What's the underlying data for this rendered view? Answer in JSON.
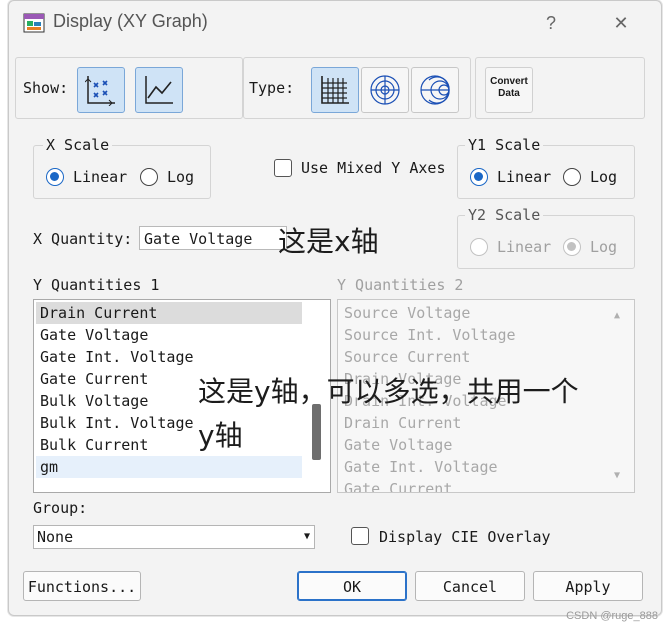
{
  "window": {
    "title": "Display (XY Graph)",
    "help": "?",
    "close": "✕"
  },
  "show": {
    "label": "Show:"
  },
  "type": {
    "label": "Type:"
  },
  "convert": {
    "line1": "Convert",
    "line2": "Data"
  },
  "x_scale": {
    "title": "X Scale",
    "linear": "Linear",
    "log": "Log",
    "selected": "Linear"
  },
  "mixed_axes": {
    "label": "Use Mixed Y Axes",
    "checked": false
  },
  "y1_scale": {
    "title": "Y1 Scale",
    "linear": "Linear",
    "log": "Log",
    "selected": "Linear"
  },
  "y2_scale": {
    "title": "Y2 Scale",
    "linear": "Linear",
    "log": "Log",
    "selected": "Log",
    "enabled": false
  },
  "x_quantity": {
    "label": "X Quantity:",
    "value": "Gate Voltage"
  },
  "y_quantities_1": {
    "label": "Y Quantities 1",
    "items": [
      "Drain Current",
      "Gate Voltage",
      "Gate Int. Voltage",
      "Gate Current",
      "Bulk Voltage",
      "Bulk Int. Voltage",
      "Bulk Current",
      "gm"
    ]
  },
  "y_quantities_2": {
    "label": "Y Quantities 2",
    "items": [
      "Source Voltage",
      "Source Int. Voltage",
      "Source Current",
      "Drain Voltage",
      "Drain Int. Voltage",
      "Drain Current",
      "Gate Voltage",
      "Gate Int. Voltage",
      "Gate Current"
    ]
  },
  "group": {
    "label": "Group:",
    "value": "None"
  },
  "cie_overlay": {
    "label": "Display CIE Overlay",
    "checked": false
  },
  "buttons": {
    "functions": "Functions...",
    "ok": "OK",
    "cancel": "Cancel",
    "apply": "Apply"
  },
  "annotations": {
    "x_axis": "这是x轴",
    "y_axis_line1": "这是y轴，可以多选，共用一个",
    "y_axis_line2": "y轴"
  },
  "watermark": "CSDN @ruge_888",
  "colors": {
    "accent": "#1a67c6",
    "selected_button": "#cfe3f6"
  }
}
